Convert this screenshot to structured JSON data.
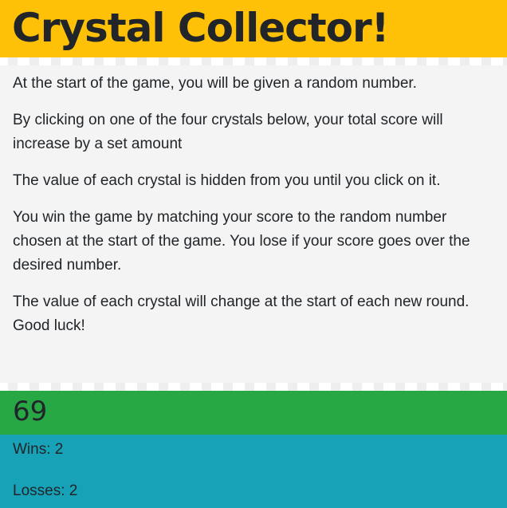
{
  "title": "Crystal Collector!",
  "instructions": [
    "At the start of the game, you will be given a random number.",
    "By clicking on one of the four crystals below, your total score will increase by a set amount",
    "The value of each crystal is hidden from you until you click on it.",
    "You win the game by matching your score to the random number chosen at the start of the game. You lose if your score goes over the desired number.",
    "The value of each crystal will change at the start of each new round. Good luck!"
  ],
  "target_number": "69",
  "wins": "Wins: 2",
  "losses": "Losses: 2",
  "colors": {
    "header": "#ffc107",
    "target": "#28a745",
    "stats": "#17a2b8"
  }
}
